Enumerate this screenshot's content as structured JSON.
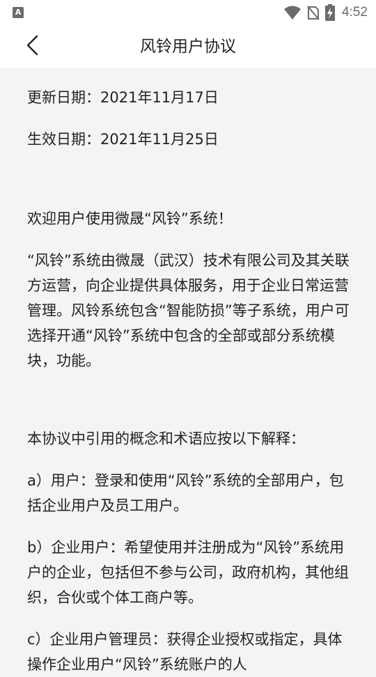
{
  "status_bar": {
    "left_icon_letter": "A",
    "time": "4:52"
  },
  "header": {
    "title": "风铃用户协议"
  },
  "content": {
    "update_date": "更新日期：2021年11月17日",
    "effective_date": "生效日期：2021年11月25日",
    "welcome": "欢迎用户使用微晟“风铃”系统！",
    "intro": "“风铃”系统由微晟（武汉）技术有限公司及其关联方运营，向企业提供具体服务，用于企业日常运营管理。风铃系统包含“智能防损”等子系统，用户可选择开通“风铃”系统中包含的全部或部分系统模块，功能。",
    "terms_intro": "本协议中引用的概念和术语应按以下解释：",
    "term_a": "a）用户：登录和使用“风铃”系统的全部用户，包括企业用户及员工用户。",
    "term_b": "b）企业用户：希望使用并注册成为“风铃”系统用户的企业，包括但不参与公司，政府机构，其他组织，合伙或个体工商户等。",
    "term_c": "c）企业用户管理员：获得企业授权或指定，具体操作企业用户“风铃”系统账户的人"
  }
}
